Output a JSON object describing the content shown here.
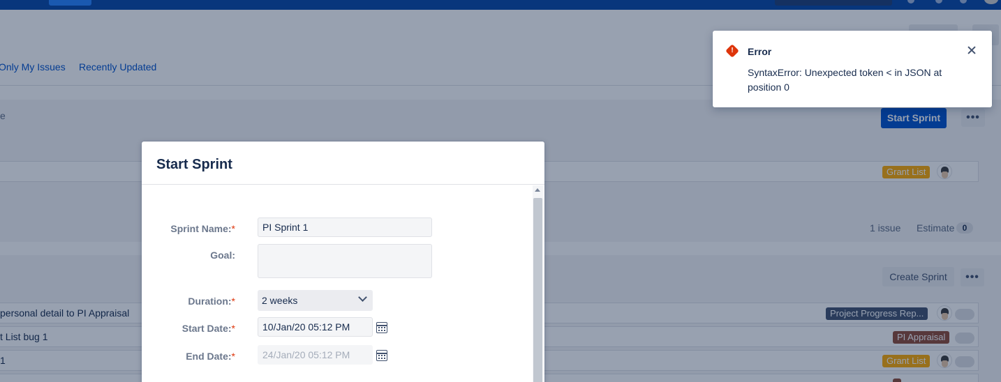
{
  "filters": {
    "only_my_issues": "Only My Issues",
    "recently_updated": "Recently Updated"
  },
  "active_sprint": {
    "truncated_text": "e",
    "start_sprint_label": "Start Sprint",
    "more_label": "•••",
    "rows": [
      {
        "summary": "",
        "epic": "Grant List",
        "epic_color": "#ffab00"
      }
    ],
    "issue_count": "1 issue",
    "estimate_label": "Estimate",
    "estimate_value": "0"
  },
  "backlog": {
    "create_sprint_label": "Create Sprint",
    "more_label": "•••",
    "rows": [
      {
        "summary": "personal detail to PI Appraisal",
        "epic": "Project Progress Rep...",
        "epic_color": "#42526e"
      },
      {
        "summary": "t List bug 1",
        "epic": "PI Appraisal",
        "epic_color": "#8f4a36"
      },
      {
        "summary": "1",
        "epic": "Grant List",
        "epic_color": "#ffab00"
      }
    ]
  },
  "dialog": {
    "title": "Start Sprint",
    "sprint_name_label": "Sprint Name:",
    "sprint_name_value": "PI Sprint 1",
    "goal_label": "Goal:",
    "goal_value": "",
    "duration_label": "Duration:",
    "duration_value": "2 weeks",
    "start_date_label": "Start Date:",
    "start_date_value": "10/Jan/20 05:12 PM",
    "end_date_label": "End Date:",
    "end_date_value": "24/Jan/20 05:12 PM",
    "required_marker": "*"
  },
  "toast": {
    "title": "Error",
    "message": "SyntaxError: Unexpected token < in JSON at position 0",
    "icon": "error-icon",
    "icon_glyph": "!"
  },
  "colors": {
    "primary": "#0052cc",
    "nav": "#0747a6",
    "error": "#de350b"
  }
}
